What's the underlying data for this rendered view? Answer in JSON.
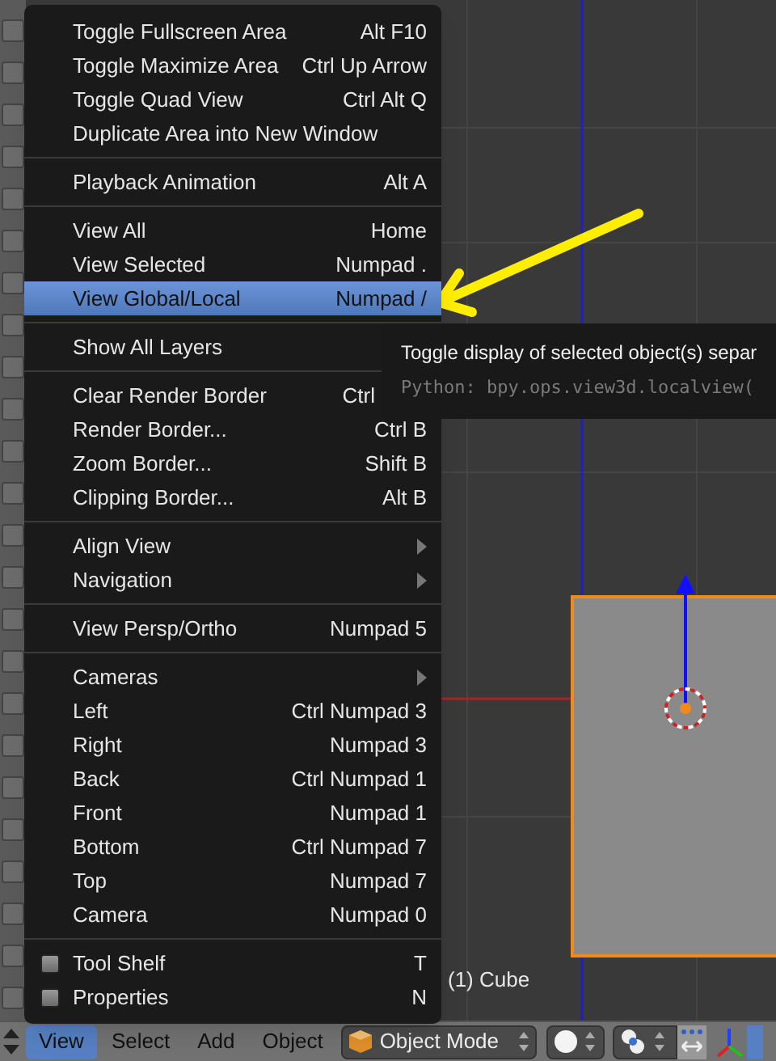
{
  "view_menu": {
    "sections": [
      [
        {
          "kind": "item",
          "label": "Toggle Fullscreen Area",
          "shortcut": "Alt F10",
          "selected": false
        },
        {
          "kind": "item",
          "label": "Toggle Maximize Area",
          "shortcut": "Ctrl Up Arrow",
          "selected": false
        },
        {
          "kind": "item",
          "label": "Toggle Quad View",
          "shortcut": "Ctrl Alt Q",
          "selected": false
        },
        {
          "kind": "item",
          "label": "Duplicate Area into New Window",
          "selected": false
        }
      ],
      [
        {
          "kind": "item",
          "label": "Playback Animation",
          "shortcut": "Alt A",
          "selected": false
        }
      ],
      [
        {
          "kind": "item",
          "label": "View All",
          "shortcut": "Home",
          "selected": false
        },
        {
          "kind": "item",
          "label": "View Selected",
          "shortcut": "Numpad .",
          "selected": false
        },
        {
          "kind": "item",
          "label": "View Global/Local",
          "shortcut": "Numpad /",
          "selected": true
        }
      ],
      [
        {
          "kind": "item",
          "label": "Show All Layers",
          "selected": false
        }
      ],
      [
        {
          "kind": "overlapped",
          "label": "Clear Render Border",
          "shortcut": "Ctrl",
          "selected": false
        },
        {
          "kind": "item",
          "label": "Render Border...",
          "shortcut": "Ctrl B",
          "selected": false
        },
        {
          "kind": "item",
          "label": "Zoom Border...",
          "shortcut": "Shift B",
          "selected": false
        },
        {
          "kind": "item",
          "label": "Clipping Border...",
          "shortcut": "Alt B",
          "selected": false
        }
      ],
      [
        {
          "kind": "submenu",
          "label": "Align View",
          "selected": false
        },
        {
          "kind": "submenu",
          "label": "Navigation",
          "selected": false
        }
      ],
      [
        {
          "kind": "item",
          "label": "View Persp/Ortho",
          "shortcut": "Numpad 5",
          "selected": false
        }
      ],
      [
        {
          "kind": "submenu",
          "label": "Cameras",
          "selected": false
        },
        {
          "kind": "item",
          "label": "Left",
          "shortcut": "Ctrl Numpad 3",
          "selected": false
        },
        {
          "kind": "item",
          "label": "Right",
          "shortcut": "Numpad 3",
          "selected": false
        },
        {
          "kind": "item",
          "label": "Back",
          "shortcut": "Ctrl Numpad 1",
          "selected": false
        },
        {
          "kind": "item",
          "label": "Front",
          "shortcut": "Numpad 1",
          "selected": false
        },
        {
          "kind": "item",
          "label": "Bottom",
          "shortcut": "Ctrl Numpad 7",
          "selected": false
        },
        {
          "kind": "item",
          "label": "Top",
          "shortcut": "Numpad 7",
          "selected": false
        },
        {
          "kind": "item",
          "label": "Camera",
          "shortcut": "Numpad 0",
          "selected": false
        }
      ],
      [
        {
          "kind": "checkbox",
          "label": "Tool Shelf",
          "shortcut": "T",
          "checked": false,
          "selected": false
        },
        {
          "kind": "checkbox",
          "label": "Properties",
          "shortcut": "N",
          "checked": false,
          "selected": false
        }
      ]
    ]
  },
  "tooltip": {
    "description": "Toggle display of selected object(s) separ",
    "python": "Python: bpy.ops.view3d.localview("
  },
  "viewport": {
    "object_label": "(1) Cube"
  },
  "header": {
    "menus": [
      {
        "label": "View",
        "selected": true
      },
      {
        "label": "Select",
        "selected": false
      },
      {
        "label": "Add",
        "selected": false
      },
      {
        "label": "Object",
        "selected": false
      }
    ],
    "mode": "Object Mode"
  }
}
